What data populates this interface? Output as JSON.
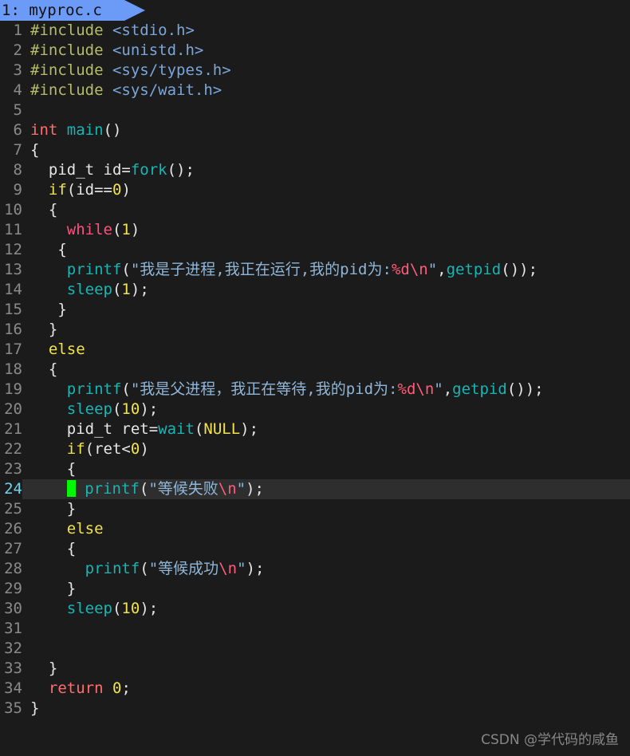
{
  "window": {
    "background_color": "#1b1b1b",
    "current_line_highlight_color": "#2e2e2e",
    "cursor_color": "#00f900"
  },
  "tab_bar": {
    "active_tab": {
      "label": "1: myproc.c",
      "index": "1",
      "filename": "myproc.c",
      "background_color": "#6b9bf7",
      "text_color": "#101010"
    }
  },
  "editor": {
    "language": "c",
    "current_line": 24,
    "total_lines": 35,
    "line_numbers": [
      "1",
      "2",
      "3",
      "4",
      "5",
      "6",
      "7",
      "8",
      "9",
      "10",
      "11",
      "12",
      "13",
      "14",
      "15",
      "16",
      "17",
      "18",
      "19",
      "20",
      "21",
      "22",
      "23",
      "24",
      "25",
      "26",
      "27",
      "28",
      "29",
      "30",
      "31",
      "32",
      "33",
      "34",
      "35"
    ],
    "lines": [
      {
        "n": "1",
        "text": "#include <stdio.h>"
      },
      {
        "n": "2",
        "text": "#include <unistd.h>"
      },
      {
        "n": "3",
        "text": "#include <sys/types.h>"
      },
      {
        "n": "4",
        "text": "#include <sys/wait.h>"
      },
      {
        "n": "5",
        "text": ""
      },
      {
        "n": "6",
        "text": "int main()"
      },
      {
        "n": "7",
        "text": "{"
      },
      {
        "n": "8",
        "text": "  pid_t id=fork();"
      },
      {
        "n": "9",
        "text": "  if(id==0)"
      },
      {
        "n": "10",
        "text": "  {"
      },
      {
        "n": "11",
        "text": "    while(1)"
      },
      {
        "n": "12",
        "text": "   {"
      },
      {
        "n": "13",
        "text": "    printf(\"我是子进程,我正在运行,我的pid为:%d\\n\",getpid());"
      },
      {
        "n": "14",
        "text": "    sleep(1);"
      },
      {
        "n": "15",
        "text": "   }"
      },
      {
        "n": "16",
        "text": "  }"
      },
      {
        "n": "17",
        "text": "  else"
      },
      {
        "n": "18",
        "text": "  {"
      },
      {
        "n": "19",
        "text": "    printf(\"我是父进程，我正在等待,我的pid为:%d\\n\",getpid());"
      },
      {
        "n": "20",
        "text": "    sleep(10);"
      },
      {
        "n": "21",
        "text": "    pid_t ret=wait(NULL);"
      },
      {
        "n": "22",
        "text": "    if(ret<0)"
      },
      {
        "n": "23",
        "text": "    {"
      },
      {
        "n": "24",
        "text": "      printf(\"等候失败\\n\");"
      },
      {
        "n": "25",
        "text": "    }"
      },
      {
        "n": "26",
        "text": "    else"
      },
      {
        "n": "27",
        "text": "    {"
      },
      {
        "n": "28",
        "text": "      printf(\"等候成功\\n\");"
      },
      {
        "n": "29",
        "text": "    }"
      },
      {
        "n": "30",
        "text": "    sleep(10);"
      },
      {
        "n": "31",
        "text": ""
      },
      {
        "n": "32",
        "text": ""
      },
      {
        "n": "33",
        "text": "  }"
      },
      {
        "n": "34",
        "text": "  return 0;"
      },
      {
        "n": "35",
        "text": "}"
      }
    ]
  },
  "watermark": {
    "text": "CSDN @学代码的咸鱼"
  }
}
